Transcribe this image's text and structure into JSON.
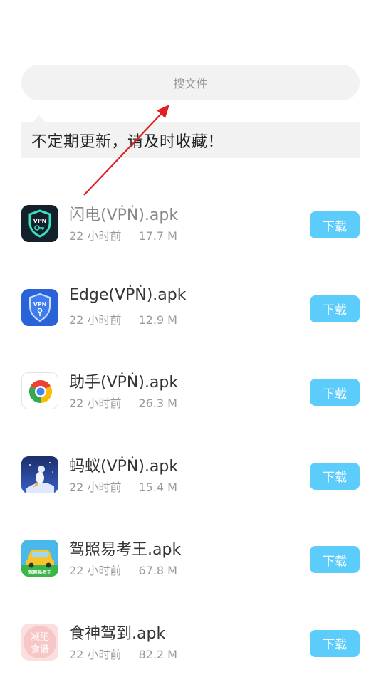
{
  "search": {
    "placeholder": "搜文件"
  },
  "notice": {
    "text": "不定期更新，请及时收藏！"
  },
  "files": [
    {
      "name": "闪电(VṖṄ).apk",
      "time": "22 小时前",
      "size": "17.7 M",
      "download_label": "下载",
      "icon": "vpn-shield-key-icon"
    },
    {
      "name": "Edge(VṖṄ).apk",
      "time": "22 小时前",
      "size": "12.9 M",
      "download_label": "下载",
      "icon": "vpn-shield-blue-icon"
    },
    {
      "name": "助手(VṖṄ).apk",
      "time": "22 小时前",
      "size": "26.3 M",
      "download_label": "下载",
      "icon": "chrome-ring-icon"
    },
    {
      "name": "蚂蚁(VṖṄ).apk",
      "time": "22 小时前",
      "size": "15.4 M",
      "download_label": "下载",
      "icon": "ant-rocket-icon"
    },
    {
      "name": "驾照易考王.apk",
      "time": "22 小时前",
      "size": "67.8 M",
      "download_label": "下载",
      "icon": "car-driving-icon",
      "icon_text": "驾照易考王"
    },
    {
      "name": "食神驾到.apk",
      "time": "22 小时前",
      "size": "82.2 M",
      "download_label": "下载",
      "icon": "diet-recipe-icon",
      "icon_text": "减肥食谱"
    }
  ],
  "colors": {
    "download_button": "#5ccdfb",
    "arrow": "#e02020"
  }
}
